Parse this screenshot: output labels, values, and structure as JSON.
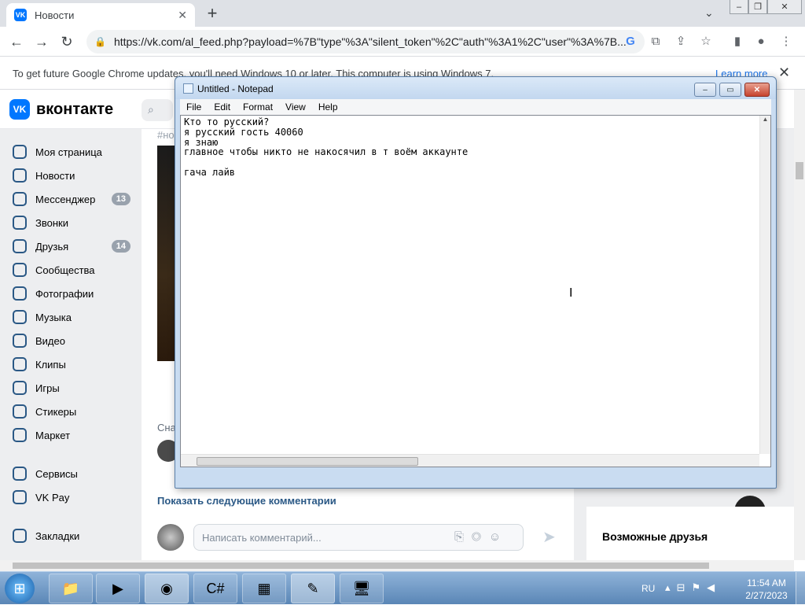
{
  "browser": {
    "tab_title": "Новости",
    "tab_favicon": "VK",
    "tab_close": "✕",
    "new_tab": "+",
    "url": "https://vk.com/al_feed.php?payload=%7B\"type\"%3A\"silent_token\"%2C\"auth\"%3A1%2C\"user\"%3A%7B...",
    "infobar_text": "To get future Google Chrome updates, you'll need Windows 10 or later. This computer is using Windows 7.",
    "infobar_link": "Learn more",
    "infobar_close": "✕"
  },
  "vk": {
    "logo_text": "вконтакте",
    "logo_mark": "VK",
    "search_icon": "⌕",
    "sidebar": [
      {
        "label": "Моя страница",
        "icon": "user-icon"
      },
      {
        "label": "Новости",
        "icon": "news-icon"
      },
      {
        "label": "Мессенджер",
        "icon": "messenger-icon",
        "badge": "13"
      },
      {
        "label": "Звонки",
        "icon": "phone-icon"
      },
      {
        "label": "Друзья",
        "icon": "friends-icon",
        "badge": "14"
      },
      {
        "label": "Сообщества",
        "icon": "communities-icon"
      },
      {
        "label": "Фотографии",
        "icon": "photos-icon"
      },
      {
        "label": "Музыка",
        "icon": "music-icon"
      },
      {
        "label": "Видео",
        "icon": "video-icon"
      },
      {
        "label": "Клипы",
        "icon": "clips-icon"
      },
      {
        "label": "Игры",
        "icon": "games-icon"
      },
      {
        "label": "Стикеры",
        "icon": "stickers-icon"
      },
      {
        "label": "Маркет",
        "icon": "market-icon"
      },
      {
        "label": "Сервисы",
        "icon": "services-icon"
      },
      {
        "label": "VK Pay",
        "icon": "vkpay-icon"
      },
      {
        "label": "Закладки",
        "icon": "bookmarks-icon"
      }
    ],
    "feed": {
      "tag": "#но",
      "snippet": "Сна",
      "show_more": "Показать следующие комментарии",
      "comment_placeholder": "Написать комментарий..."
    },
    "right": {
      "possible_friends": "Возможные друзья"
    }
  },
  "notepad": {
    "title": "Untitled - Notepad",
    "menu": [
      "File",
      "Edit",
      "Format",
      "View",
      "Help"
    ],
    "text": "Кто то русский?\nя русский гость 40060\nя знаю\nглавное чтобы никто не накосячил в т воём аккаунте\n\nгача лайв"
  },
  "taskbar": {
    "language": "RU",
    "time": "11:54 AM",
    "date": "2/27/2023"
  }
}
